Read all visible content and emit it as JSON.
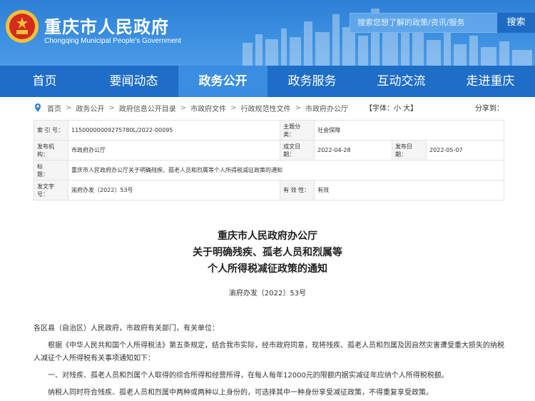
{
  "header": {
    "title": "重庆市人民政府",
    "subtitle": "Chongqing Municipal People's Government",
    "search_placeholder": "搜索您想了解的政策/资讯/服务",
    "search_label": "搜索"
  },
  "nav": {
    "items": [
      {
        "label": "首页"
      },
      {
        "label": "要闻动态"
      },
      {
        "label": "政务公开"
      },
      {
        "label": "政务服务"
      },
      {
        "label": "互动交流"
      },
      {
        "label": "走进重庆"
      }
    ]
  },
  "breadcrumb": {
    "items": [
      "首页",
      "政务公开",
      "政府信息公开目录",
      "市政府文件",
      "行政规范性文件",
      "市政府办公厅"
    ],
    "font_size_label": "【字体：",
    "font_small": "小",
    "font_large": "大",
    "font_close": "】",
    "share_label": "分享到："
  },
  "meta": {
    "index_key": "索 引 号：",
    "index_val": "11500000009275780L/2022-00095",
    "category_key": "主题分类：",
    "category_val": "社会保障",
    "issuer_key": "发布机构：",
    "issuer_val": "市政府办公厅",
    "created_key": "成文日期：",
    "created_val": "2022-04-28",
    "published_key": "发布日期：",
    "published_val": "2022-05-07",
    "title_key": "标　　题：",
    "title_val": "重庆市人民政府办公厅关于明确残疾、孤老人员和烈属等个人所得税减征政策的通知",
    "doc_no_key": "发文字号：",
    "doc_no_val": "渝府办发〔2022〕53号",
    "validity_key": "有 效 性：",
    "validity_val": "有效"
  },
  "document": {
    "title_line1": "重庆市人民政府办公厅",
    "title_line2": "关于明确残疾、孤老人员和烈属等",
    "title_line3": "个人所得税减征政策的通知",
    "doc_no": "渝府办发〔2022〕53号",
    "salutation": "各区县（自治区）人民政府，市政府有关部门，有关单位：",
    "para1": "根据《中华人民共和国个人所得税法》第五条规定，结合我市实际，经市政府同意，现将残疾、孤老人员和烈属及因自然灾害遭受重大损失的纳税人减征个人所得税有关事项通知如下：",
    "para2": "一、对残疾、孤老人员和烈属个人取得的综合所得和经营所得，在每人每年12000元的限额内据实减征年应纳个人所得税税额。",
    "para3": "纳税人同时符合残疾、孤老人员和烈属中两种或两种以上身份的，可选择其中一种身份享受减征政策，不得重复享受政策。"
  }
}
